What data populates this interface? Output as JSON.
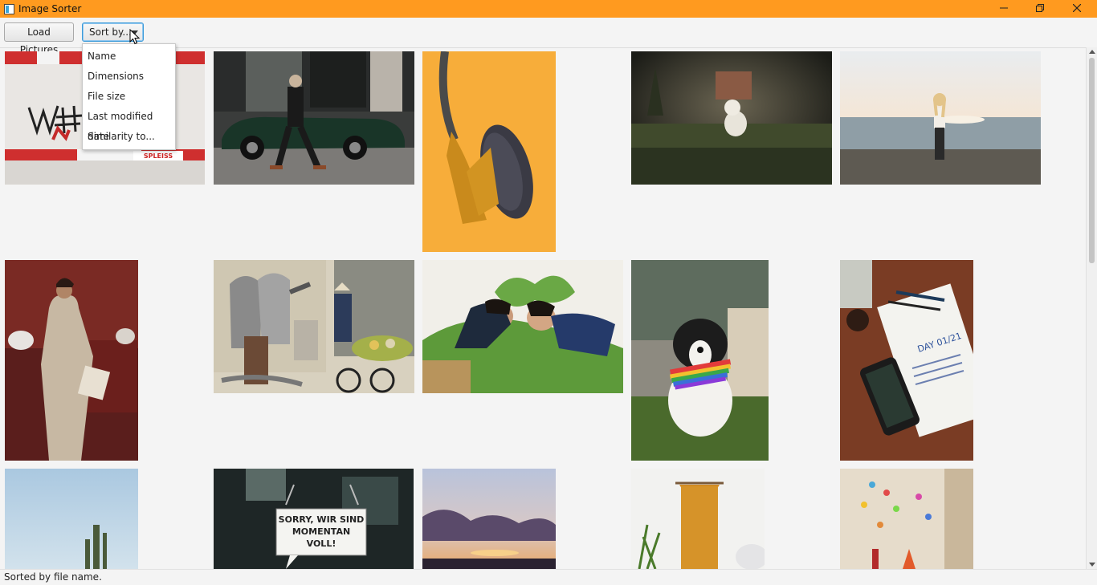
{
  "window": {
    "title": "Image Sorter",
    "titlebar_color": "#ff9a1f",
    "controls": [
      "minimize-icon",
      "restore-icon",
      "close-icon"
    ]
  },
  "toolbar": {
    "load_label": "Load Pictures",
    "sort_label": "Sort by..."
  },
  "sort_menu": {
    "items": [
      "Name",
      "Dimensions",
      "File size",
      "Last modified date",
      "Similarity to..."
    ]
  },
  "gallery": {
    "photos": [
      {
        "name": "photo-graffiti-wall"
      },
      {
        "name": "photo-street-vintage-car"
      },
      {
        "name": "photo-headphones-yellow"
      },
      {
        "name": "photo-dog-in-field"
      },
      {
        "name": "photo-woman-at-sea"
      },
      {
        "name": "photo-woman-in-dress"
      },
      {
        "name": "photo-street-mural-vendor"
      },
      {
        "name": "photo-two-women-grass"
      },
      {
        "name": "photo-dog-rainbow-scarf"
      },
      {
        "name": "photo-notebook-phone-desk"
      },
      {
        "name": "photo-cactus-sky"
      },
      {
        "name": "photo-shop-sign"
      },
      {
        "name": "photo-sunset-clouds"
      },
      {
        "name": "photo-macrame-wall"
      },
      {
        "name": "photo-kitchen-magnets"
      }
    ],
    "sign_text": "SORRY, WIR SIND MOMENTAN VOLL!",
    "notebook_text": "DAY 01/21",
    "graffiti_text": "SPLEISS"
  },
  "status": {
    "text": "Sorted by file name."
  }
}
